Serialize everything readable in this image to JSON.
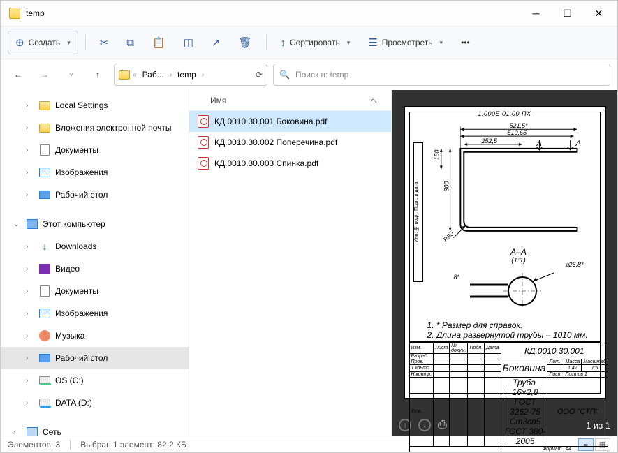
{
  "window": {
    "title": "temp"
  },
  "toolbar": {
    "new": "Создать",
    "sort": "Сортировать",
    "view": "Просмотреть"
  },
  "breadcrumb": {
    "seg1": "Раб...",
    "seg2": "temp"
  },
  "search": {
    "placeholder": "Поиск в: temp"
  },
  "nav": {
    "local_settings": "Local Settings",
    "attachments": "Вложения электронной почты",
    "documents": "Документы",
    "images": "Изображения",
    "desktop": "Рабочий стол",
    "this_pc": "Этот компьютер",
    "downloads": "Downloads",
    "video": "Видео",
    "documents2": "Документы",
    "images2": "Изображения",
    "music": "Музыка",
    "desktop2": "Рабочий стол",
    "os": "OS (C:)",
    "data": "DATA (D:)",
    "network": "Сеть"
  },
  "filecol": {
    "header": "Имя",
    "files": [
      "КД.0010.30.001 Боковина.pdf",
      "КД.0010.30.002 Поперечина.pdf",
      "КД.0010.30.003 Спинка.pdf"
    ]
  },
  "preview": {
    "gost": "1.000E 01.00 ПХ",
    "dim_5215": "521,5*",
    "dim_51065": "510,65",
    "dim_2525": "252,5",
    "dim_A1": "A",
    "dim_A2": "A",
    "dim_150": "150",
    "dim_300": "300",
    "dim_r30": "R30",
    "section_AA": "А–А",
    "section_scale": "(1:1)",
    "dim_8": "8*",
    "dim_268": "⌀26,8*",
    "note1": "1. * Размер для справок.",
    "note2": "2. Длина развернутой трубы – 1010 мм.",
    "tb": {
      "dwgno": "КД.0010.30.001",
      "name": "Боковина",
      "org": "ООО \"СТП\"",
      "mat1": "16×2,8 ГОСТ 3262-75",
      "mat2": "Ст3сп5 ГОСТ 380-2005",
      "lit": "Лит.",
      "mass": "Масса",
      "scale": "Масштаб",
      "mass_v": "1,42",
      "scale_v": "1:5",
      "sheet": "Лист",
      "sheets": "Листов 1",
      "fmt": "Формат",
      "a4": "А4",
      "truba": "Труба",
      "izm": "Изм.",
      "list_hdr": "Лист",
      "ndok": "№ докум.",
      "podp": "Подп.",
      "data": "Дата",
      "razrab": "Разраб.",
      "prov": "Пров.",
      "tkontr": "Т.контр.",
      "nkontr": "Н.контр.",
      "utv": "Утв."
    },
    "page_info": "1 из 1"
  },
  "status": {
    "count": "Элементов: 3",
    "selection": "Выбран 1 элемент: 82,2 КБ"
  }
}
